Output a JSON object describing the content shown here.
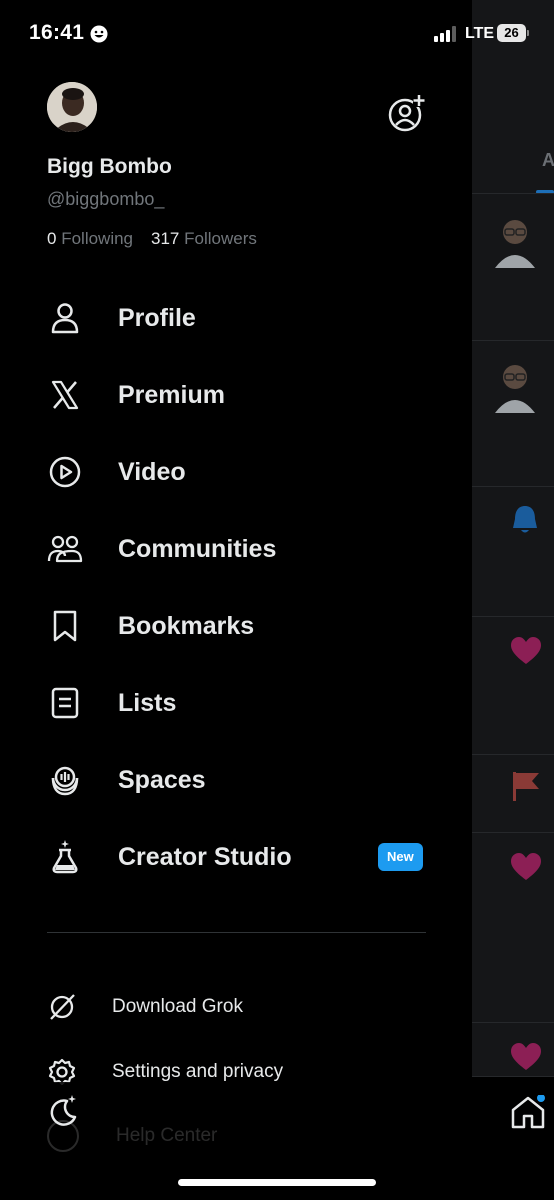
{
  "status_bar": {
    "time": "16:41",
    "network": "LTE",
    "battery": "26"
  },
  "profile": {
    "name": "Bigg Bombo",
    "handle": "@biggbombo_",
    "following_count": "0",
    "following_label": "Following",
    "followers_count": "317",
    "followers_label": "Followers"
  },
  "menu": {
    "items": [
      {
        "label": "Profile",
        "icon": "person-icon"
      },
      {
        "label": "Premium",
        "icon": "x-logo-icon"
      },
      {
        "label": "Video",
        "icon": "play-circle-icon"
      },
      {
        "label": "Communities",
        "icon": "communities-icon"
      },
      {
        "label": "Bookmarks",
        "icon": "bookmark-icon"
      },
      {
        "label": "Lists",
        "icon": "list-icon"
      },
      {
        "label": "Spaces",
        "icon": "spaces-icon"
      },
      {
        "label": "Creator Studio",
        "icon": "flask-icon",
        "badge": "New"
      }
    ]
  },
  "secondary": {
    "download_grok": "Download Grok",
    "settings": "Settings and privacy",
    "help": "Help Center"
  },
  "colors": {
    "accent": "#1d9bf0",
    "background": "#000000",
    "muted": "#71767b",
    "like": "#f91880"
  }
}
